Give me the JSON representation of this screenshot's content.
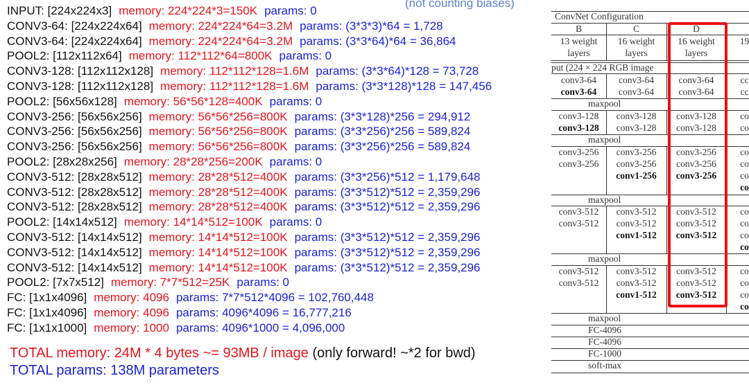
{
  "note": "(not counting biases)",
  "layers": [
    {
      "label": "INPUT: [224x224x3]",
      "memory": "memory:  224*224*3=150K",
      "params": "params: 0"
    },
    {
      "label": "CONV3-64: [224x224x64]",
      "memory": "memory:  224*224*64=3.2M",
      "params": "params: (3*3*3)*64 = 1,728"
    },
    {
      "label": "CONV3-64: [224x224x64]",
      "memory": "memory:  224*224*64=3.2M",
      "params": "params: (3*3*64)*64 = 36,864"
    },
    {
      "label": "POOL2: [112x112x64]",
      "memory": "memory:  112*112*64=800K",
      "params": "params: 0"
    },
    {
      "label": "CONV3-128: [112x112x128]",
      "memory": "memory:  112*112*128=1.6M",
      "params": "params: (3*3*64)*128 = 73,728"
    },
    {
      "label": "CONV3-128: [112x112x128]",
      "memory": "memory:  112*112*128=1.6M",
      "params": "params: (3*3*128)*128 = 147,456"
    },
    {
      "label": "POOL2: [56x56x128]",
      "memory": "memory:  56*56*128=400K",
      "params": "params: 0"
    },
    {
      "label": "CONV3-256: [56x56x256]",
      "memory": "memory:  56*56*256=800K",
      "params": "params: (3*3*128)*256 = 294,912"
    },
    {
      "label": "CONV3-256: [56x56x256]",
      "memory": "memory:  56*56*256=800K",
      "params": "params: (3*3*256)*256 = 589,824"
    },
    {
      "label": "CONV3-256: [56x56x256]",
      "memory": "memory:  56*56*256=800K",
      "params": "params: (3*3*256)*256 = 589,824"
    },
    {
      "label": "POOL2: [28x28x256]",
      "memory": "memory:  28*28*256=200K",
      "params": "params: 0"
    },
    {
      "label": "CONV3-512: [28x28x512]",
      "memory": "memory:  28*28*512=400K",
      "params": "params: (3*3*256)*512 = 1,179,648"
    },
    {
      "label": "CONV3-512: [28x28x512]",
      "memory": "memory:  28*28*512=400K",
      "params": "params: (3*3*512)*512 = 2,359,296"
    },
    {
      "label": "CONV3-512: [28x28x512]",
      "memory": "memory:  28*28*512=400K",
      "params": "params: (3*3*512)*512 = 2,359,296"
    },
    {
      "label": "POOL2: [14x14x512]",
      "memory": "memory:  14*14*512=100K",
      "params": "params: 0"
    },
    {
      "label": "CONV3-512: [14x14x512]",
      "memory": "memory:  14*14*512=100K",
      "params": "params: (3*3*512)*512 = 2,359,296"
    },
    {
      "label": "CONV3-512: [14x14x512]",
      "memory": "memory:  14*14*512=100K",
      "params": "params: (3*3*512)*512 = 2,359,296"
    },
    {
      "label": "CONV3-512: [14x14x512]",
      "memory": "memory:  14*14*512=100K",
      "params": "params: (3*3*512)*512 = 2,359,296"
    },
    {
      "label": "POOL2: [7x7x512]",
      "memory": "memory:  7*7*512=25K",
      "params": "params: 0"
    },
    {
      "label": "FC: [1x1x4096]",
      "memory": "memory:  4096",
      "params": "params: 7*7*512*4096 = 102,760,448"
    },
    {
      "label": "FC: [1x1x4096]",
      "memory": "memory:  4096",
      "params": "params: 4096*4096 = 16,777,216"
    },
    {
      "label": "FC: [1x1x1000]",
      "memory": "memory:  1000",
      "params": "params: 4096*1000 = 4,096,000"
    }
  ],
  "totals": {
    "memory": "TOTAL memory: 24M * 4 bytes ~= 93MB / image",
    "memory_note": "(only forward! ~*2 for bwd)",
    "params": "TOTAL params: 138M parameters"
  },
  "table": {
    "title": "ConvNet Configuration",
    "columns": [
      {
        "name": "B",
        "desc": [
          "13 weight",
          "layers"
        ]
      },
      {
        "name": "C",
        "desc": [
          "16 weight",
          "layers"
        ]
      },
      {
        "name": "D",
        "desc": [
          "16 weight",
          "layers"
        ]
      },
      {
        "name": "",
        "desc": [
          "19",
          ""
        ]
      }
    ],
    "input": "put (224 × 224 RGB image",
    "blocks": [
      {
        "type": "conv",
        "cells": [
          [
            {
              "t": "conv3-64"
            },
            {
              "t": "conv3-64",
              "b": true
            }
          ],
          [
            {
              "t": "conv3-64"
            },
            {
              "t": "conv3-64"
            }
          ],
          [
            {
              "t": "conv3-64"
            },
            {
              "t": "conv3-64"
            }
          ],
          [
            {
              "t": "cc"
            },
            {
              "t": "cc"
            }
          ]
        ]
      },
      {
        "type": "span",
        "text": "maxpool"
      },
      {
        "type": "conv",
        "cells": [
          [
            {
              "t": "conv3-128"
            },
            {
              "t": "conv3-128",
              "b": true
            }
          ],
          [
            {
              "t": "conv3-128"
            },
            {
              "t": "conv3-128"
            }
          ],
          [
            {
              "t": "conv3-128"
            },
            {
              "t": "conv3-128"
            }
          ],
          [
            {
              "t": "co"
            },
            {
              "t": "co"
            }
          ]
        ]
      },
      {
        "type": "span",
        "text": "maxpool"
      },
      {
        "type": "conv",
        "cells": [
          [
            {
              "t": "conv3-256"
            },
            {
              "t": "conv3-256"
            }
          ],
          [
            {
              "t": "conv3-256"
            },
            {
              "t": "conv3-256"
            },
            {
              "t": "conv1-256",
              "b": true
            }
          ],
          [
            {
              "t": "conv3-256"
            },
            {
              "t": "conv3-256"
            },
            {
              "t": "conv3-256",
              "b": true
            }
          ],
          [
            {
              "t": "co"
            },
            {
              "t": "co"
            },
            {
              "t": "co"
            },
            {
              "t": "co",
              "b": true
            }
          ]
        ]
      },
      {
        "type": "span",
        "text": "maxpool"
      },
      {
        "type": "conv",
        "cells": [
          [
            {
              "t": "conv3-512"
            },
            {
              "t": "conv3-512"
            }
          ],
          [
            {
              "t": "conv3-512"
            },
            {
              "t": "conv3-512"
            },
            {
              "t": "conv1-512",
              "b": true
            }
          ],
          [
            {
              "t": "conv3-512"
            },
            {
              "t": "conv3-512"
            },
            {
              "t": "conv3-512",
              "b": true
            }
          ],
          [
            {
              "t": "co"
            },
            {
              "t": "co"
            },
            {
              "t": "co"
            },
            {
              "t": "co",
              "b": true
            }
          ]
        ]
      },
      {
        "type": "span",
        "text": "maxpool"
      },
      {
        "type": "conv",
        "cells": [
          [
            {
              "t": "conv3-512"
            },
            {
              "t": "conv3-512"
            }
          ],
          [
            {
              "t": "conv3-512"
            },
            {
              "t": "conv3-512"
            },
            {
              "t": "conv1-512",
              "b": true
            }
          ],
          [
            {
              "t": "conv3-512"
            },
            {
              "t": "conv3-512"
            },
            {
              "t": "conv3-512",
              "b": true
            }
          ],
          [
            {
              "t": "co"
            },
            {
              "t": "co"
            },
            {
              "t": "co"
            },
            {
              "t": "co",
              "b": true
            }
          ]
        ]
      },
      {
        "type": "span",
        "text": "maxpool"
      },
      {
        "type": "span",
        "text": "FC-4096"
      },
      {
        "type": "span",
        "text": "FC-4096"
      },
      {
        "type": "span",
        "text": "FC-1000"
      },
      {
        "type": "span",
        "text": "soft-max"
      }
    ],
    "highlight_column": "D",
    "highlight_color": "#ee1111"
  }
}
